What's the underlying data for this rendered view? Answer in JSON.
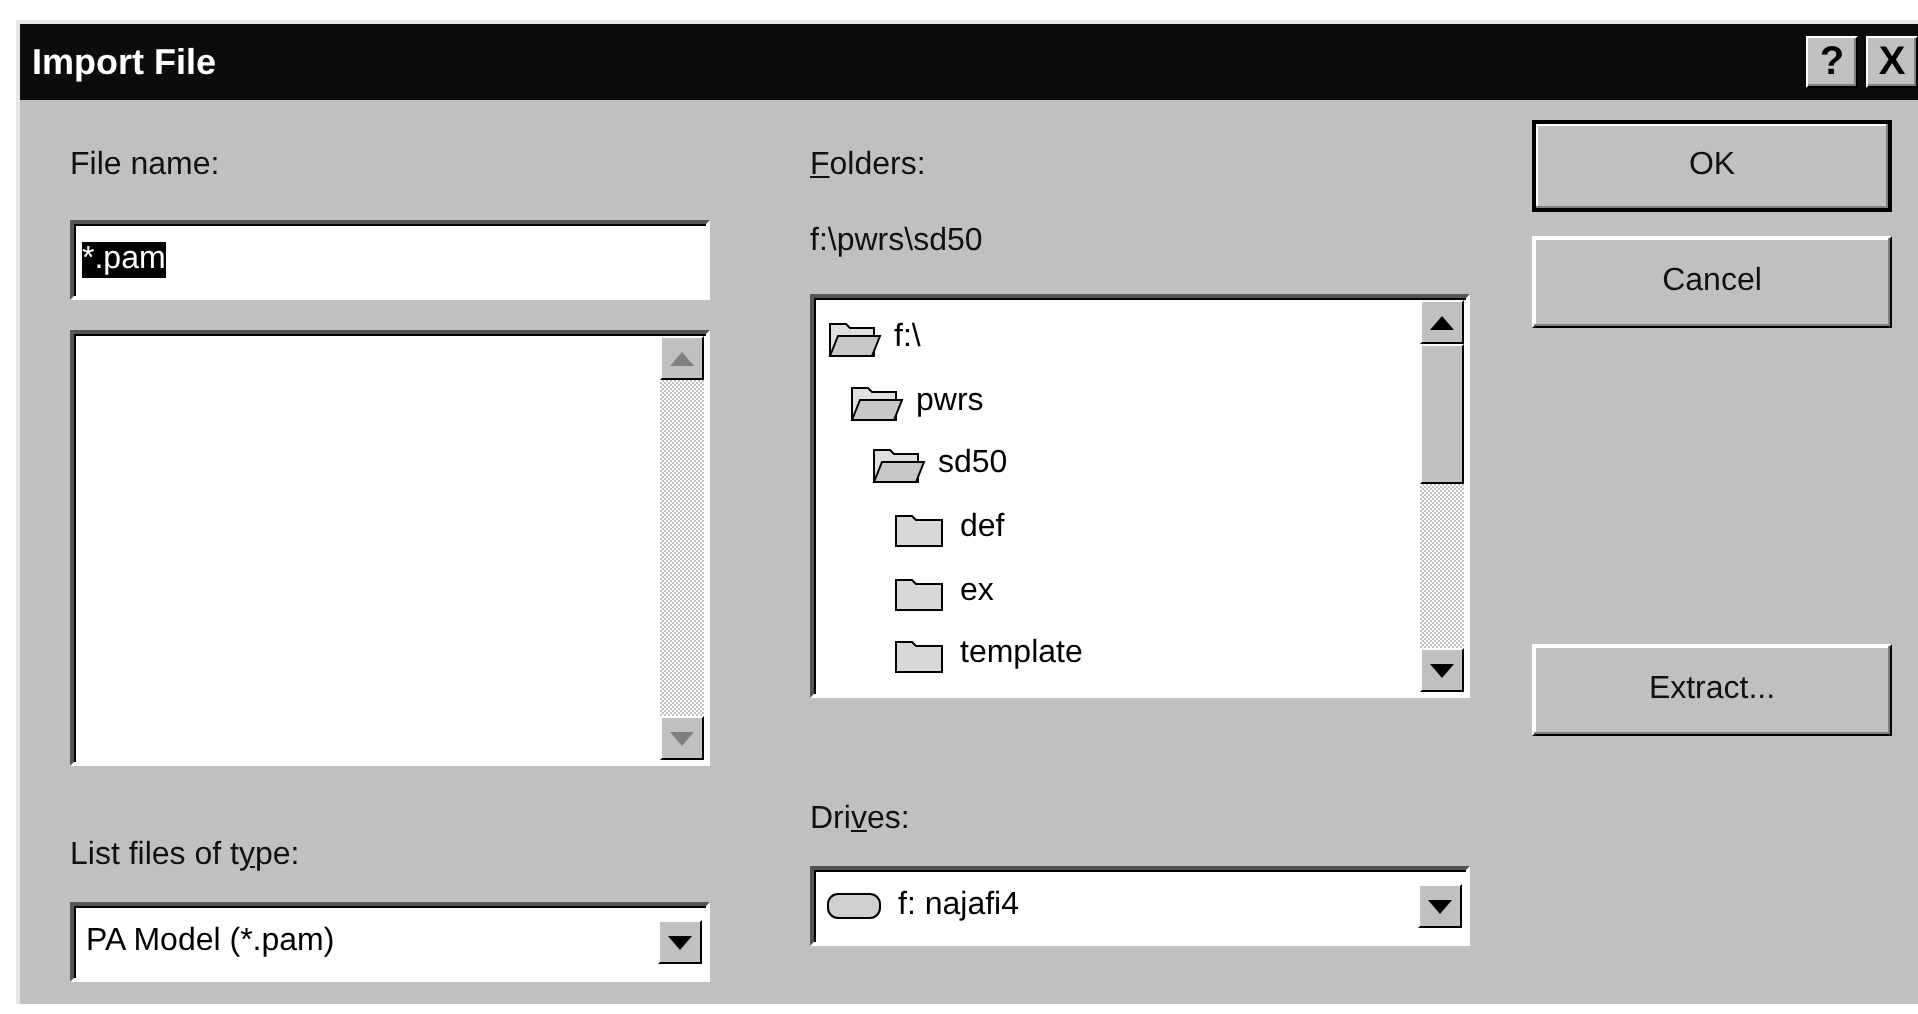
{
  "window": {
    "title": "Import File",
    "title_buttons": [
      "?",
      "X"
    ]
  },
  "file_name": {
    "label": {
      "after": "File name:"
    },
    "value": "*.pam",
    "value_selected": true
  },
  "file_list": {
    "scroll_disabled": true
  },
  "folders": {
    "label": {
      "key": "F",
      "after": "olders:"
    },
    "path": "f:\\pwrs\\sd50",
    "tree": [
      {
        "name": "f:\\",
        "expanded": true,
        "children": [
          {
            "name": "pwrs",
            "expanded": true,
            "children": [
              {
                "name": "sd50",
                "expanded": true,
                "children": [
                  {
                    "name": "def",
                    "expanded": false
                  },
                  {
                    "name": "ex",
                    "expanded": false
                  },
                  {
                    "name": "template",
                    "expanded": false
                  }
                ]
              }
            ]
          }
        ]
      }
    ],
    "scroll_disabled": false
  },
  "file_type": {
    "label": {
      "before": "List files of t",
      "key": "y",
      "after": "pe:"
    },
    "value": "PA Model (*.pam)"
  },
  "drives": {
    "label": {
      "before": "Dri",
      "key": "v",
      "after": "es:"
    },
    "value": "f: najafi4"
  },
  "buttons": [
    {
      "label": "OK",
      "default": true
    },
    {
      "label": "Cancel",
      "default": false
    },
    {
      "label": "Extract...",
      "default": false
    }
  ]
}
